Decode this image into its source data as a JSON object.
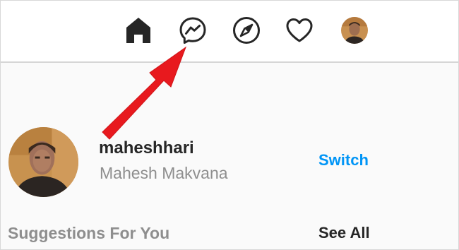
{
  "nav": {
    "icons": [
      "home-icon",
      "messenger-icon",
      "explore-compass-icon",
      "activity-heart-icon",
      "profile-avatar"
    ]
  },
  "annotation": {
    "arrow_color": "#e8191e"
  },
  "profile": {
    "username": "maheshhari",
    "full_name": "Mahesh Makvana",
    "switch_label": "Switch"
  },
  "suggestions": {
    "title": "Suggestions For You",
    "see_all_label": "See All"
  },
  "colors": {
    "link_blue": "#0095f6",
    "primary_text": "#262626",
    "secondary_text": "#8e8e8e",
    "background": "#fafafa"
  }
}
